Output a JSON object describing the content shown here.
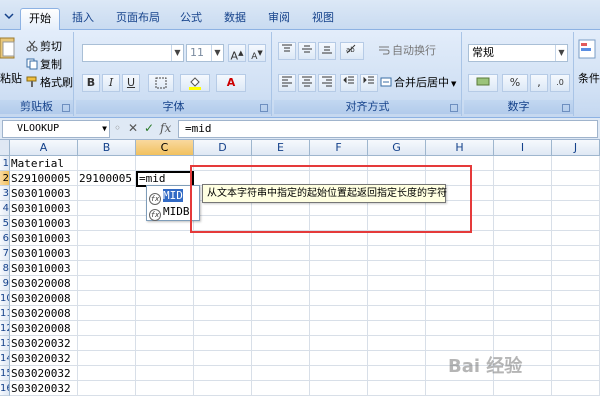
{
  "tabs": [
    {
      "label": "开始",
      "active": true
    },
    {
      "label": "插入",
      "active": false
    },
    {
      "label": "页面布局",
      "active": false
    },
    {
      "label": "公式",
      "active": false
    },
    {
      "label": "数据",
      "active": false
    },
    {
      "label": "审阅",
      "active": false
    },
    {
      "label": "视图",
      "active": false
    }
  ],
  "ribbon": {
    "clipboard": {
      "paste_label": "粘贴",
      "cut_label": "剪切",
      "copy_label": "复制",
      "format_painter_label": "格式刷",
      "group_label": "剪贴板"
    },
    "font": {
      "font_size": "11",
      "group_label": "字体"
    },
    "alignment": {
      "wrap_text_label": "自动换行",
      "merge_center_label": "合并后居中",
      "group_label": "对齐方式"
    },
    "number": {
      "format_value": "常规",
      "group_label": "数字"
    },
    "styles": {
      "conditional_label": "条件"
    }
  },
  "formula_bar": {
    "name_box": "VLOOKUP",
    "formula": "=mid"
  },
  "columns": [
    "A",
    "B",
    "C",
    "D",
    "E",
    "F",
    "G",
    "H",
    "I",
    "J"
  ],
  "rows": [
    "1",
    "2",
    "3",
    "4",
    "5",
    "6",
    "7",
    "8",
    "9",
    "10",
    "11",
    "12",
    "13",
    "14",
    "15",
    "16"
  ],
  "cells": {
    "A": [
      "Material",
      "S29100005",
      "S03010003",
      "S03010003",
      "S03010003",
      "S03010003",
      "S03010003",
      "S03010003",
      "S03020008",
      "S03020008",
      "S03020008",
      "S03020008",
      "S03020032",
      "S03020032",
      "S03020032",
      "S03020032"
    ],
    "B2": "29100005",
    "C2": "=mid"
  },
  "autocomplete": {
    "items": [
      "MID",
      "MIDB"
    ],
    "tooltip": "从文本字符串中指定的起始位置起返回指定长度的字符"
  },
  "watermark": "Bai 经验"
}
